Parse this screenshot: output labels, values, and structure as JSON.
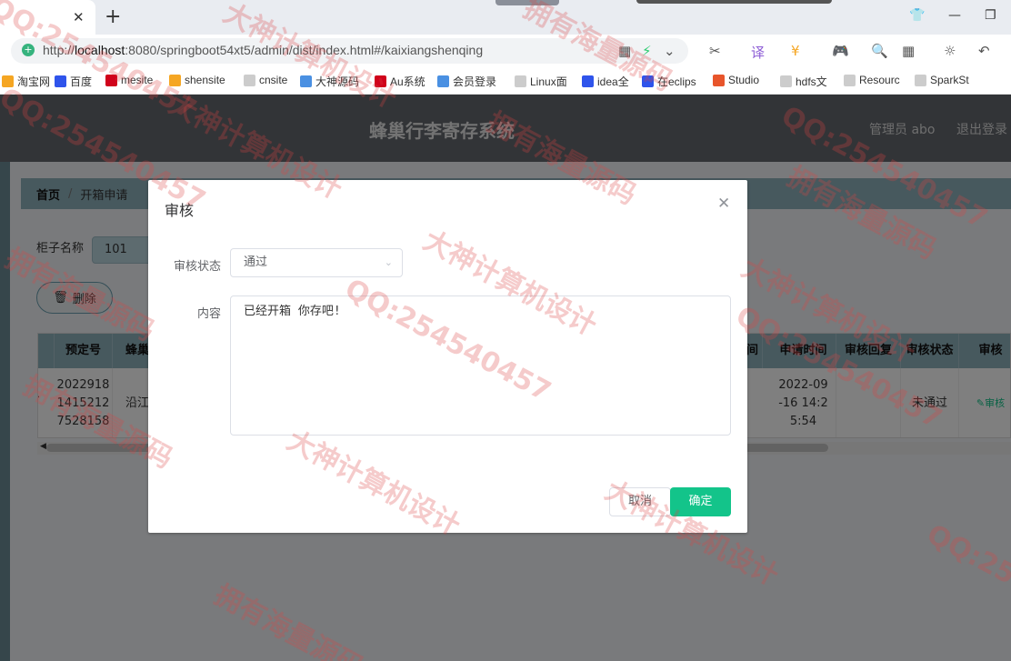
{
  "browser": {
    "url_prefix": "http://",
    "url_host": "localhost",
    "url_rest": ":8080/springboot54xt5/admin/dist/index.html#/kaixiangshenqing",
    "bookmarks": [
      {
        "label": "淘宝网",
        "color": "#f5a623"
      },
      {
        "label": "百度",
        "color": "#2f54eb"
      },
      {
        "label": "mesite",
        "color": "#d0021b"
      },
      {
        "label": "shensite",
        "color": "#f5a623"
      },
      {
        "label": "cnsite",
        "color": "#cccccc"
      },
      {
        "label": "大神源码",
        "color": "#4a90e2"
      },
      {
        "label": "Au系统",
        "color": "#d0021b"
      },
      {
        "label": "会员登录",
        "color": "#4a90e2"
      },
      {
        "label": "Linux面",
        "color": "#cccccc"
      },
      {
        "label": "idea全",
        "color": "#2f54eb"
      },
      {
        "label": "在eclips",
        "color": "#2f54eb"
      },
      {
        "label": "Studio",
        "color": "#e8552b"
      },
      {
        "label": "hdfs文",
        "color": "#cccccc"
      },
      {
        "label": "Resourc",
        "color": "#cccccc"
      },
      {
        "label": "SparkSt",
        "color": "#cccccc"
      }
    ]
  },
  "app": {
    "title": "蜂巢行李寄存系统",
    "user": "管理员 abo",
    "logout": "退出登录"
  },
  "breadcrumb": {
    "home": "首页",
    "separator": "/",
    "current": "开箱申请"
  },
  "search": {
    "label": "柜子名称",
    "value": "101"
  },
  "toolbar": {
    "delete_label": "删除"
  },
  "table": {
    "headers": [
      "预定号",
      "蜂巢",
      "申请时间",
      "审核回复",
      "审核状态",
      "审核"
    ],
    "row": {
      "order_no": "2022918\n1415212\n7528158",
      "hive": "沿江",
      "apply_time": "2022-09\n-16 14:2\n5:54",
      "reply": "",
      "status": "未通过",
      "action": "审核"
    },
    "partial_header": "间"
  },
  "dialog": {
    "title": "审核",
    "status_label": "审核状态",
    "status_value": "通过",
    "content_label": "内容",
    "content_value": "已经开箱 你存吧!",
    "cancel_label": "取消",
    "confirm_label": "确定"
  },
  "watermarks": [
    "QQ:254540457",
    "大神计算机设计",
    "拥有海量源码",
    "QQ:254540457",
    "大神计算机设计",
    "拥有海量源码",
    "QQ:254540457",
    "大神计算机设计",
    "拥有海量源码",
    "QQ:254540457",
    "大神计算机设计",
    "拥有海量源码",
    "QQ:254540457",
    "大神计算机设计",
    "拥有海量源码",
    "QQ:254540457",
    "大神计算机设计",
    "拥有海量源码"
  ],
  "colors": {
    "primary": "#13c48a",
    "header": "#64686f",
    "table_header": "#8fb2bd"
  }
}
